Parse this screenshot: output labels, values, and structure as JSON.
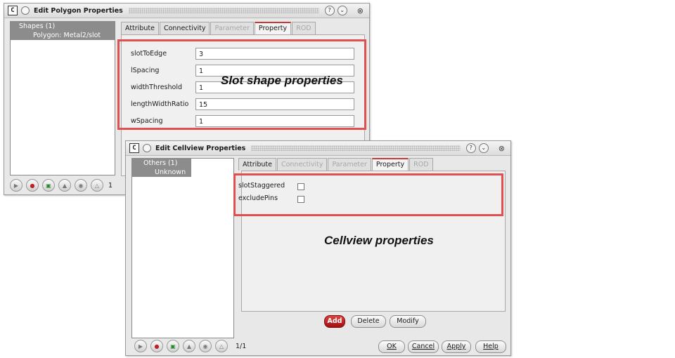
{
  "polygon_window": {
    "title": "Edit Polygon Properties",
    "tree": {
      "root": "Shapes (1)",
      "child": "Polygon: Metal2/slot"
    },
    "tabs": [
      {
        "label": "Attribute",
        "state": "normal"
      },
      {
        "label": "Connectivity",
        "state": "normal"
      },
      {
        "label": "Parameter",
        "state": "disabled"
      },
      {
        "label": "Property",
        "state": "active"
      },
      {
        "label": "ROD",
        "state": "disabled"
      }
    ],
    "properties": [
      {
        "label": "slotToEdge",
        "value": "3"
      },
      {
        "label": "lSpacing",
        "value": "1"
      },
      {
        "label": "widthThreshold",
        "value": "1"
      },
      {
        "label": "lengthWidthRatio",
        "value": "15"
      },
      {
        "label": "wSpacing",
        "value": "1"
      }
    ],
    "counter": "1"
  },
  "cellview_window": {
    "title": "Edit Cellview Properties",
    "tree": {
      "root": "Others (1)",
      "child": "Unknown"
    },
    "tabs": [
      {
        "label": "Attribute",
        "state": "normal"
      },
      {
        "label": "Connectivity",
        "state": "disabled"
      },
      {
        "label": "Parameter",
        "state": "disabled"
      },
      {
        "label": "Property",
        "state": "active"
      },
      {
        "label": "ROD",
        "state": "disabled"
      }
    ],
    "properties": [
      {
        "label": "slotStaggered",
        "checked": false
      },
      {
        "label": "excludePins",
        "checked": false
      }
    ],
    "buttons": {
      "add": "Add",
      "delete": "Delete",
      "modify": "Modify"
    },
    "counter": "1/1",
    "footer": {
      "ok": "OK",
      "cancel": "Cancel",
      "apply": "Apply",
      "help": "Help"
    }
  },
  "annotations": {
    "slot": "Slot shape properties",
    "cellview": "Cellview properties"
  },
  "colors": {
    "highlight": "#e05050",
    "tree_selection": "#8c8c8c",
    "active_tab": "#c83a3a",
    "add_button": "#c02020"
  }
}
